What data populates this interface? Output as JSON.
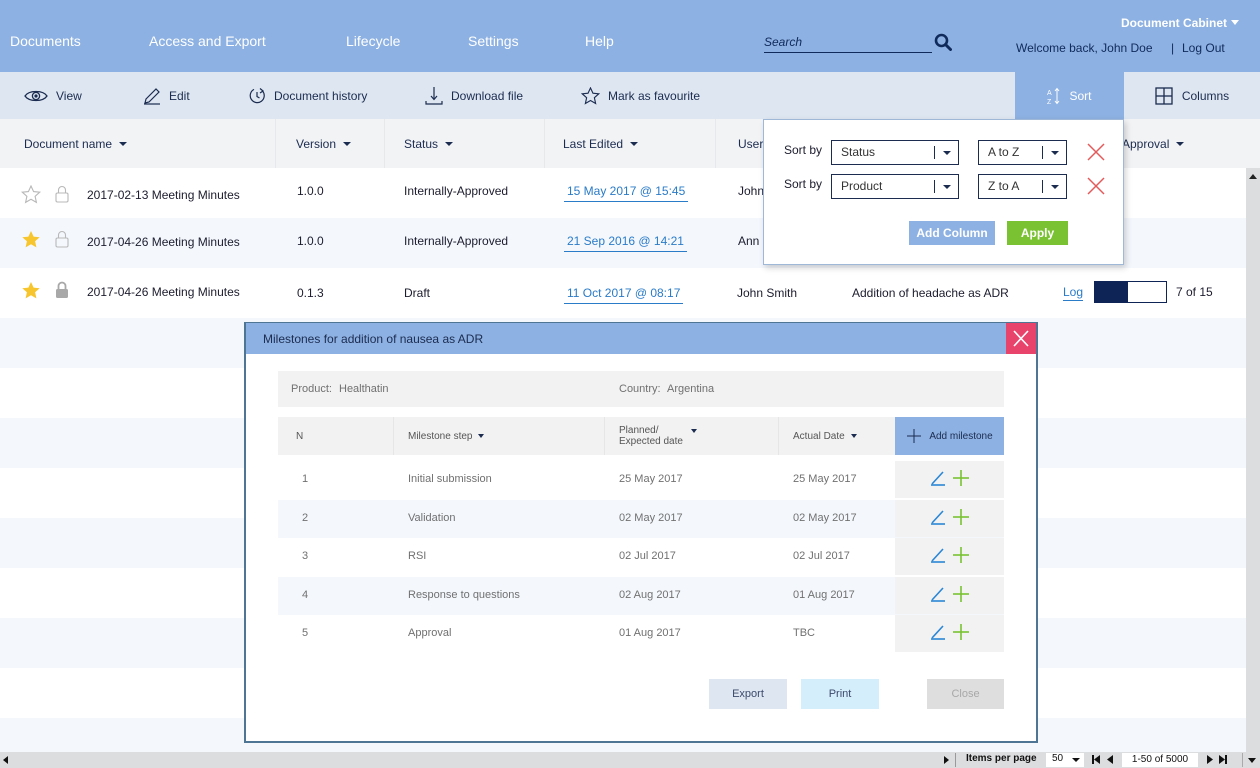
{
  "nav": {
    "items": [
      "Documents",
      "Access and Export",
      "Lifecycle",
      "Settings",
      "Help"
    ],
    "search_placeholder": "Search",
    "cabinet": "Document Cabinet",
    "welcome": "Welcome back, John Doe",
    "separator": "|",
    "logout": "Log Out"
  },
  "toolbar": {
    "view": "View",
    "edit": "Edit",
    "history": "Document history",
    "download": "Download file",
    "favourite": "Mark as favourite",
    "sort": "Sort",
    "columns": "Columns"
  },
  "table": {
    "headers": {
      "name": "Document name",
      "version": "Version",
      "status": "Status",
      "last_edited": "Last Edited",
      "user": "User",
      "approval": "Approval"
    },
    "rows": [
      {
        "favourite": false,
        "locked": false,
        "name": "2017-02-13 Meeting Minutes",
        "version": "1.0.0",
        "status": "Internally-Approved",
        "last_edited": "15 May 2017 @ 15:45",
        "user": "John"
      },
      {
        "favourite": true,
        "locked": false,
        "name": "2017-04-26 Meeting Minutes",
        "version": "1.0.0",
        "status": "Internally-Approved",
        "last_edited": "21 Sep 2016 @ 14:21",
        "user": "Ann"
      },
      {
        "favourite": true,
        "locked": true,
        "name": "2017-04-26 Meeting Minutes",
        "version": "0.1.3",
        "status": "Draft",
        "last_edited": "11 Oct 2017 @ 08:17",
        "user": "John Smith",
        "change": "Addition of headache as ADR",
        "log": "Log",
        "progress_done": 7,
        "progress_total": 15,
        "progress_text": "7 of 15"
      }
    ]
  },
  "sort_popup": {
    "label": "Sort by",
    "rules": [
      {
        "column": "Status",
        "order": "A to Z"
      },
      {
        "column": "Product",
        "order": "Z to A"
      }
    ],
    "add_column": "Add Column",
    "apply": "Apply"
  },
  "modal": {
    "title": "Milestones for addition of nausea as ADR",
    "product_label": "Product:",
    "product": "Healthatin",
    "country_label": "Country:",
    "country": "Argentina",
    "headers": {
      "n": "N",
      "step": "Milestone step",
      "planned_line1": "Planned/",
      "planned_line2": "Expected date",
      "actual": "Actual Date",
      "add": "Add milestone"
    },
    "rows": [
      {
        "n": "1",
        "step": "Initial submission",
        "planned": "25 May 2017",
        "actual": "25 May 2017"
      },
      {
        "n": "2",
        "step": "Validation",
        "planned": "02 May 2017",
        "actual": "02 May 2017"
      },
      {
        "n": "3",
        "step": "RSI",
        "planned": "02 Jul 2017",
        "actual": "02 Jul 2017"
      },
      {
        "n": "4",
        "step": "Response to questions",
        "planned": "02 Aug 2017",
        "actual": "01 Aug 2017"
      },
      {
        "n": "5",
        "step": "Approval",
        "planned": "01 Aug 2017",
        "actual": "TBC"
      }
    ],
    "export": "Export",
    "print": "Print",
    "close": "Close"
  },
  "pagination": {
    "items_per_page_label": "Items per page",
    "items_per_page": "50",
    "range": "1-50 of 5000"
  },
  "colors": {
    "nav_bg": "#8db1e2",
    "toolbar_bg": "#dde6f1",
    "link": "#2a7bc8",
    "favourite": "#f7c52d",
    "apply_green": "#7ac231",
    "close_red": "#e8436a",
    "progress_navy": "#0e2457"
  }
}
